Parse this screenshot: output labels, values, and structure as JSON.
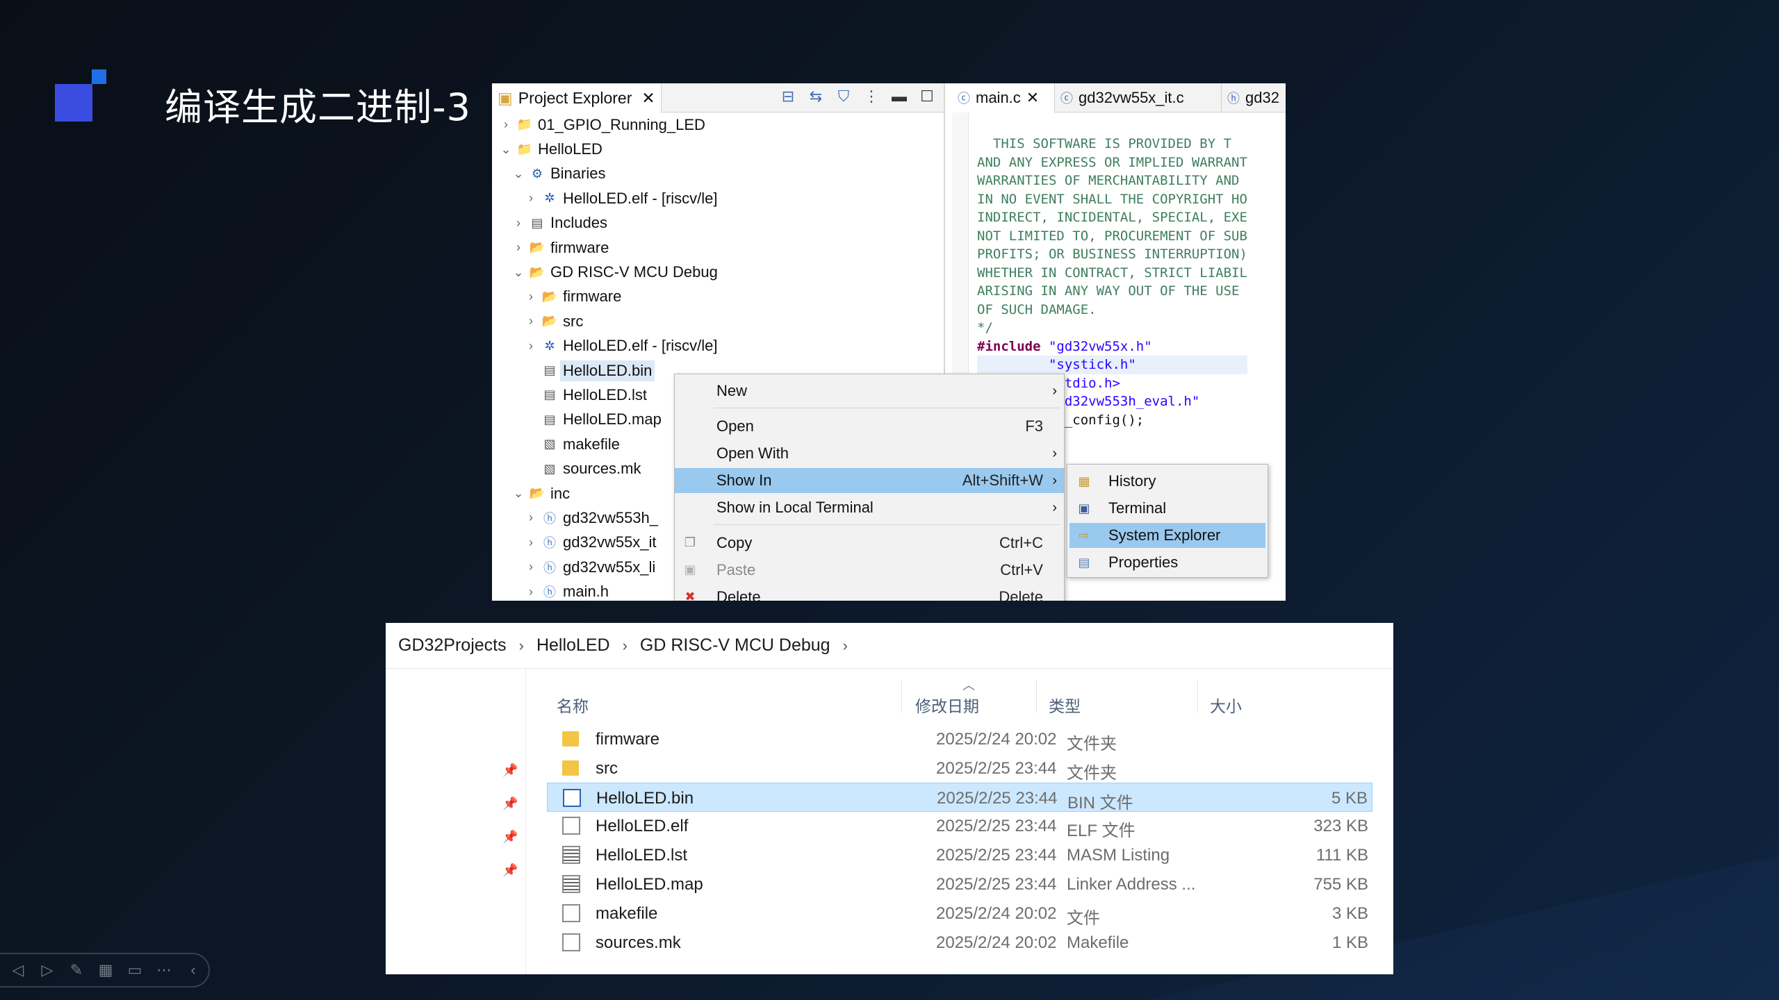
{
  "slide": {
    "title": "编译生成二进制-3"
  },
  "eclipse": {
    "project_explorer": {
      "tab_label": "Project Explorer",
      "tree": [
        {
          "label": "01_GPIO_Running_LED",
          "depth": 0,
          "expanded": false,
          "icon": "project-icon"
        },
        {
          "label": "HelloLED",
          "depth": 0,
          "expanded": true,
          "icon": "project-icon"
        },
        {
          "label": "Binaries",
          "depth": 1,
          "expanded": true,
          "icon": "binaries-icon"
        },
        {
          "label": "HelloLED.elf - [riscv/le]",
          "depth": 2,
          "expanded": false,
          "icon": "elf-icon"
        },
        {
          "label": "Includes",
          "depth": 1,
          "expanded": false,
          "icon": "includes-icon"
        },
        {
          "label": "firmware",
          "depth": 1,
          "expanded": false,
          "icon": "folder-icon"
        },
        {
          "label": "GD RISC-V MCU Debug",
          "depth": 1,
          "expanded": true,
          "icon": "folder-icon"
        },
        {
          "label": "firmware",
          "depth": 2,
          "expanded": false,
          "icon": "folder-icon"
        },
        {
          "label": "src",
          "depth": 2,
          "expanded": false,
          "icon": "folder-icon"
        },
        {
          "label": "HelloLED.elf - [riscv/le]",
          "depth": 2,
          "expanded": false,
          "icon": "elf-icon"
        },
        {
          "label": "HelloLED.bin",
          "depth": 2,
          "leaf": true,
          "selected": true,
          "icon": "file-icon"
        },
        {
          "label": "HelloLED.lst",
          "depth": 2,
          "leaf": true,
          "icon": "file-icon"
        },
        {
          "label": "HelloLED.map",
          "depth": 2,
          "leaf": true,
          "icon": "file-icon"
        },
        {
          "label": "makefile",
          "depth": 2,
          "leaf": true,
          "icon": "makefile-icon"
        },
        {
          "label": "sources.mk",
          "depth": 2,
          "leaf": true,
          "icon": "makefile-icon"
        },
        {
          "label": "inc",
          "depth": 1,
          "expanded": true,
          "icon": "folder-icon"
        },
        {
          "label": "gd32vw553h_",
          "depth": 2,
          "expanded": false,
          "icon": "header-icon"
        },
        {
          "label": "gd32vw55x_it",
          "depth": 2,
          "expanded": false,
          "icon": "header-icon"
        },
        {
          "label": "gd32vw55x_li",
          "depth": 2,
          "expanded": false,
          "icon": "header-icon"
        },
        {
          "label": "main.h",
          "depth": 2,
          "expanded": false,
          "icon": "header-icon"
        }
      ]
    },
    "editor": {
      "tabs": [
        {
          "label": "main.c",
          "active": true,
          "closable": true
        },
        {
          "label": "gd32vw55x_it.c",
          "active": false
        },
        {
          "label": "gd32",
          "active": false
        }
      ],
      "comment_lines": [
        "  THIS SOFTWARE IS PROVIDED BY T",
        "AND ANY EXPRESS OR IMPLIED WARRANT",
        "WARRANTIES OF MERCHANTABILITY AND",
        "IN NO EVENT SHALL THE COPYRIGHT HO",
        "INDIRECT, INCIDENTAL, SPECIAL, EXE",
        "NOT LIMITED TO, PROCUREMENT OF SUB",
        "PROFITS; OR BUSINESS INTERRUPTION)",
        "WHETHER IN CONTRACT, STRICT LIABIL",
        "ARISING IN ANY WAY OUT OF THE USE",
        "OF SUCH DAMAGE.",
        "*/"
      ],
      "include_keyword": "#include",
      "include_values": [
        "\"gd32vw55x.h\"",
        "\"systick.h\"",
        "<stdio.h>",
        "\"gd32vw553h_eval.h\""
      ],
      "bottom_fragment": "ck_config();"
    },
    "context_menu": {
      "items": [
        {
          "label": "New",
          "accel": "",
          "submenu": true
        },
        {
          "label": "Open",
          "accel": "F3"
        },
        {
          "label": "Open With",
          "accel": "",
          "submenu": true
        },
        {
          "label": "Show In",
          "accel": "Alt+Shift+W",
          "submenu": true,
          "highlighted": true
        },
        {
          "label": "Show in Local Terminal",
          "accel": "",
          "submenu": true
        },
        {
          "label": "Copy",
          "accel": "Ctrl+C",
          "icon": "copy-icon"
        },
        {
          "label": "Paste",
          "accel": "Ctrl+V",
          "disabled": true,
          "icon": "paste-icon"
        },
        {
          "label": "Delete",
          "accel": "Delete",
          "icon": "delete-icon"
        }
      ]
    },
    "show_in_submenu": {
      "items": [
        {
          "label": "History",
          "icon": "history-icon"
        },
        {
          "label": "Terminal",
          "icon": "terminal-icon"
        },
        {
          "label": "System Explorer",
          "icon": "system-explorer-icon",
          "highlighted": true
        },
        {
          "label": "Properties",
          "icon": "properties-icon"
        }
      ]
    }
  },
  "explorer": {
    "breadcrumb": [
      "GD32Projects",
      "HelloLED",
      "GD RISC-V MCU Debug"
    ],
    "columns": {
      "name": "名称",
      "date": "修改日期",
      "type": "类型",
      "size": "大小"
    },
    "files": [
      {
        "name": "firmware",
        "date": "2025/2/24 20:02",
        "type": "文件夹",
        "size": "",
        "icon": "folder-icon"
      },
      {
        "name": "src",
        "date": "2025/2/25 23:44",
        "type": "文件夹",
        "size": "",
        "icon": "folder-icon"
      },
      {
        "name": "HelloLED.bin",
        "date": "2025/2/25 23:44",
        "type": "BIN 文件",
        "size": "5 KB",
        "icon": "bin-file-icon",
        "selected": true
      },
      {
        "name": "HelloLED.elf",
        "date": "2025/2/25 23:44",
        "type": "ELF 文件",
        "size": "323 KB",
        "icon": "file-icon"
      },
      {
        "name": "HelloLED.lst",
        "date": "2025/2/25 23:44",
        "type": "MASM Listing",
        "size": "111 KB",
        "icon": "listing-file-icon"
      },
      {
        "name": "HelloLED.map",
        "date": "2025/2/25 23:44",
        "type": "Linker Address ...",
        "size": "755 KB",
        "icon": "map-file-icon"
      },
      {
        "name": "makefile",
        "date": "2025/2/24 20:02",
        "type": "文件",
        "size": "3 KB",
        "icon": "file-icon"
      },
      {
        "name": "sources.mk",
        "date": "2025/2/24 20:02",
        "type": "Makefile",
        "size": "1 KB",
        "icon": "makefile-icon"
      }
    ]
  }
}
